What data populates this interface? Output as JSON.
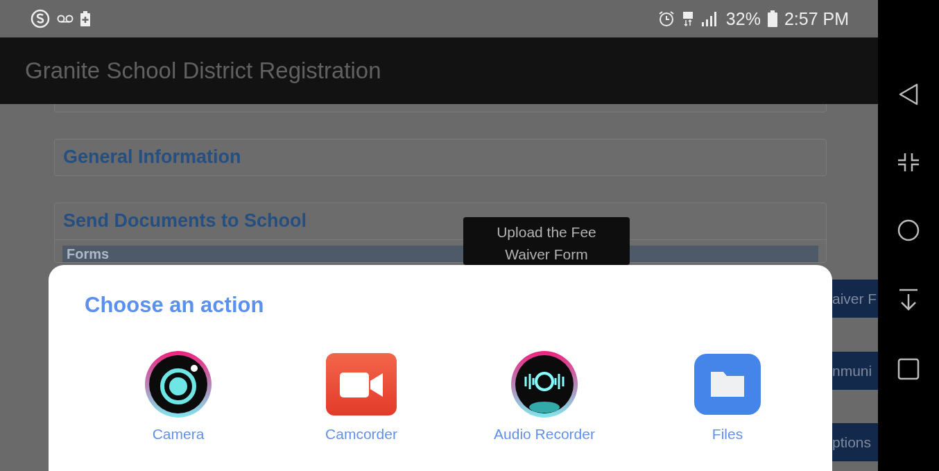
{
  "status_bar": {
    "battery": "32%",
    "time": "2:57 PM"
  },
  "app_bar": {
    "title": "Granite School District Registration"
  },
  "sections": [
    {
      "title": "General Information"
    },
    {
      "title": "Send Documents to School",
      "table_header": "Forms"
    }
  ],
  "side_buttons": [
    "aiver F",
    "nmuni",
    "ptions"
  ],
  "tooltip": "Upload the Fee Waiver Form",
  "dialog": {
    "title": "Choose an action",
    "actions": [
      {
        "label": "Camera",
        "kind": "camera"
      },
      {
        "label": "Camcorder",
        "kind": "camcorder"
      },
      {
        "label": "Audio Recorder",
        "kind": "recorder"
      },
      {
        "label": "Files",
        "kind": "files"
      }
    ]
  }
}
